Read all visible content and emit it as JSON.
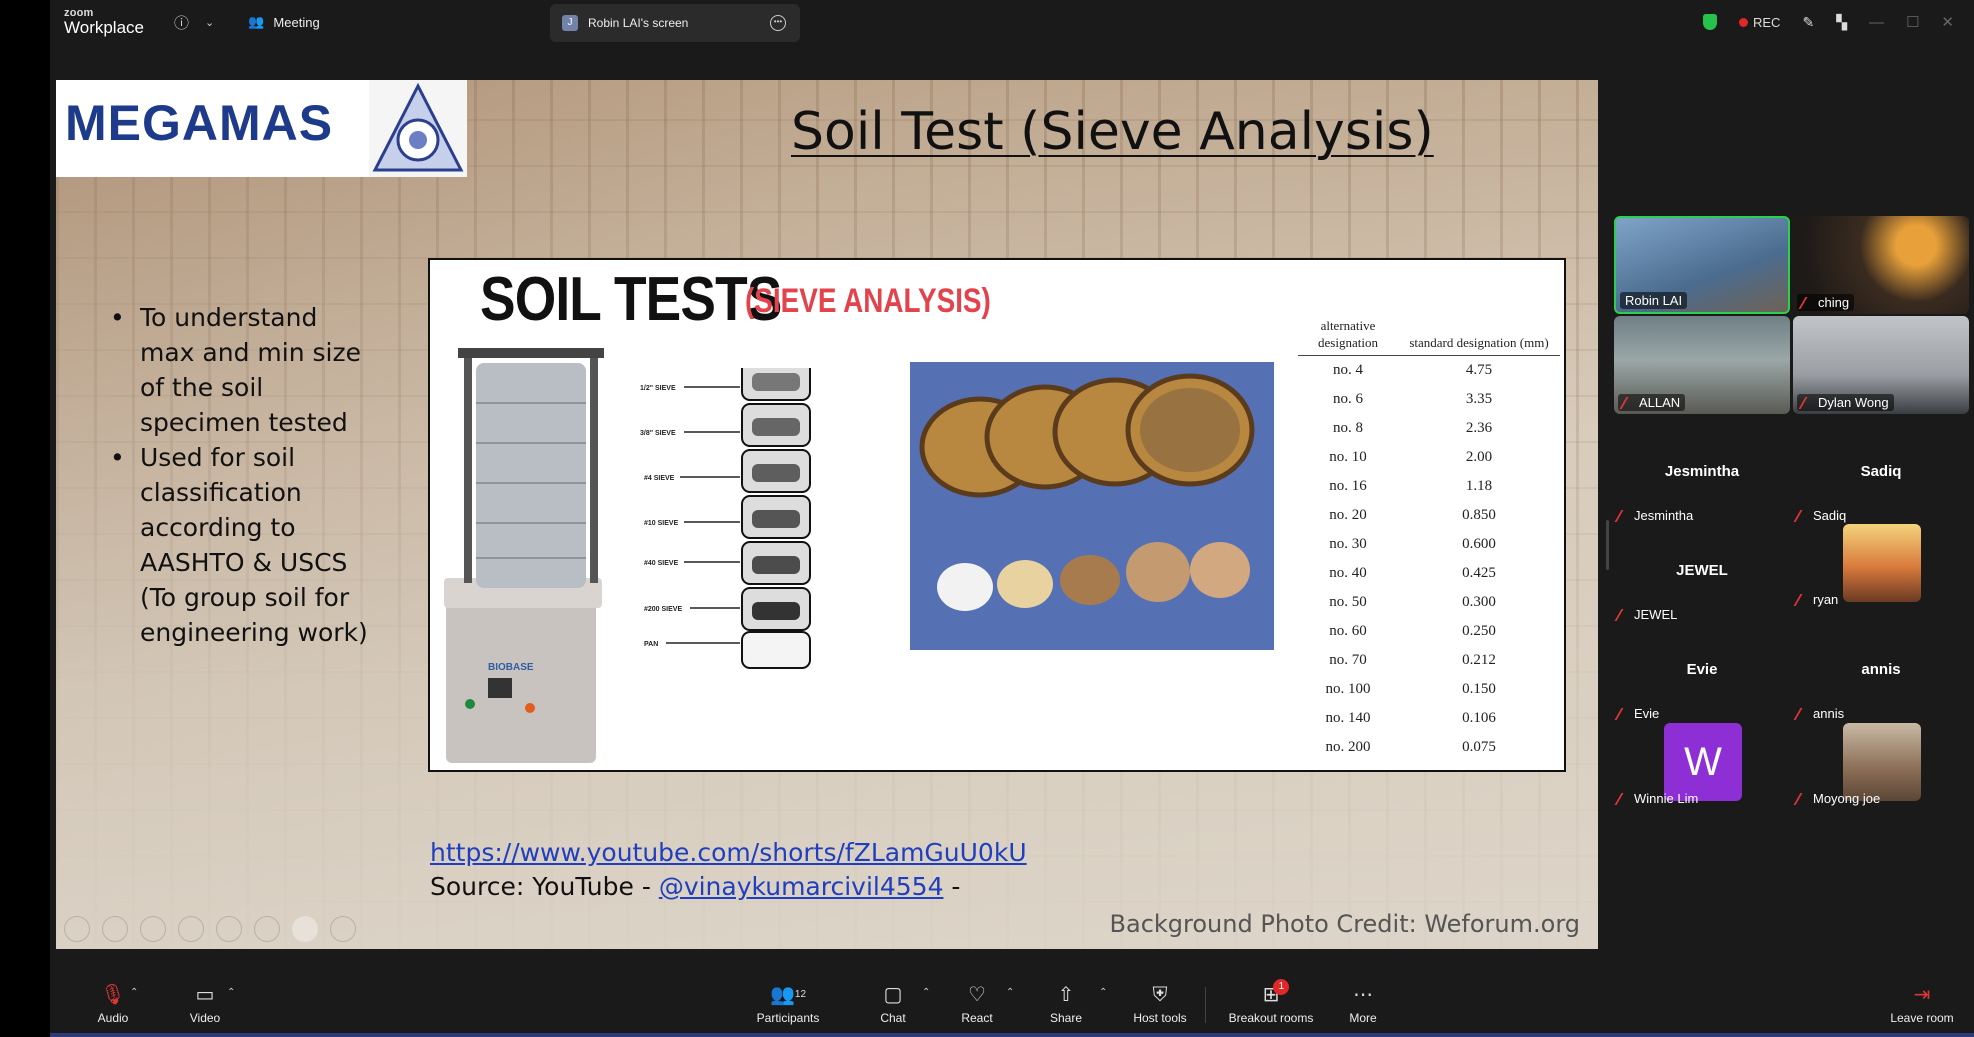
{
  "app": {
    "logo_top": "zoom",
    "logo_bottom": "Workplace",
    "meeting_label": "Meeting"
  },
  "share_tab": {
    "avatar_letter": "J",
    "label": "Robin LAI's screen"
  },
  "status": {
    "rec_label": "REC"
  },
  "slide": {
    "brand_text": "MEGAMAS",
    "title": "Soil Test (Sieve Analysis)",
    "bullets": [
      "To understand max and min size of the soil specimen tested",
      "Used for soil classification according to AASHTO  & USCS (To group soil for engineering work)"
    ],
    "panel_title": "SOIL TESTS",
    "panel_subtitle": "(SIEVE ANALYSIS)",
    "shaker_brand": "BIOBASE",
    "sieve_labels": [
      "1/2\" SIEVE",
      "3/8\" SIEVE",
      "#4 SIEVE",
      "#10 SIEVE",
      "#40 SIEVE",
      "#200 SIEVE",
      "PAN"
    ],
    "table": {
      "header_alt": "alternative designation",
      "header_std": "standard designation (mm)",
      "rows": [
        [
          "no. 4",
          "4.75"
        ],
        [
          "no. 6",
          "3.35"
        ],
        [
          "no. 8",
          "2.36"
        ],
        [
          "no. 10",
          "2.00"
        ],
        [
          "no. 16",
          "1.18"
        ],
        [
          "no. 20",
          "0.850"
        ],
        [
          "no. 30",
          "0.600"
        ],
        [
          "no. 40",
          "0.425"
        ],
        [
          "no. 50",
          "0.300"
        ],
        [
          "no. 60",
          "0.250"
        ],
        [
          "no. 70",
          "0.212"
        ],
        [
          "no. 100",
          "0.150"
        ],
        [
          "no. 140",
          "0.106"
        ],
        [
          "no. 200",
          "0.075"
        ]
      ]
    },
    "link": "https://www.youtube.com/shorts/fZLamGuU0kU",
    "source_prefix": "Source: YouTube - ",
    "source_handle": "@vinaykumarcivil4554",
    "source_suffix": " -",
    "credit": "Background Photo Credit: Weforum.org"
  },
  "participants": {
    "video_tiles": [
      {
        "name": "Robin LAI",
        "muted": false
      },
      {
        "name": "ching",
        "muted": true
      },
      {
        "name": "ALLAN",
        "muted": true
      },
      {
        "name": "Dylan Wong",
        "muted": true
      }
    ],
    "no_video": [
      {
        "display": "Jesmintha",
        "name": "Jesmintha"
      },
      {
        "display": "Sadiq",
        "name": "Sadiq"
      },
      {
        "display": "JEWEL",
        "name": "JEWEL"
      },
      {
        "display": "",
        "name": "ryan"
      },
      {
        "display": "Evie",
        "name": "Evie"
      },
      {
        "display": "annis",
        "name": "annis"
      },
      {
        "display": "W",
        "name": "Winnie Lim"
      },
      {
        "display": "",
        "name": "Moyong joe"
      }
    ]
  },
  "toolbar": {
    "audio": "Audio",
    "video": "Video",
    "participants": "Participants",
    "participants_count": "12",
    "chat": "Chat",
    "react": "React",
    "share": "Share",
    "host_tools": "Host tools",
    "breakout": "Breakout rooms",
    "breakout_badge": "1",
    "more": "More",
    "leave": "Leave room"
  },
  "colors": {
    "accent_green": "#2bd14c",
    "rec_red": "#e02828",
    "link_blue": "#1f3fbf",
    "brand_blue": "#1e3a8a"
  },
  "icons": [
    "info-icon",
    "people-icon",
    "more-icon",
    "shield-icon",
    "pen-icon",
    "layout-icon",
    "mic-muted-icon",
    "camera-icon",
    "participants-icon",
    "chat-icon",
    "react-icon",
    "share-icon",
    "host-shield-icon",
    "breakout-icon",
    "more-dots-icon",
    "leave-icon"
  ]
}
